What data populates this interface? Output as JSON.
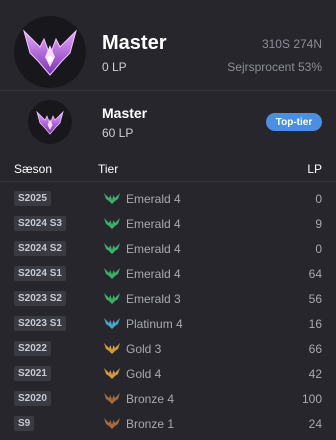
{
  "current": {
    "tier": "Master",
    "lp": "0 LP",
    "record": "310S 274N",
    "winrate": "Sejrsprocent 53%",
    "icon": "master-emblem-icon",
    "color": "#b05adf"
  },
  "peak": {
    "tier": "Master",
    "lp": "60 LP",
    "badge": "Top-tier",
    "badge_color": "#4b8fe3",
    "icon": "master-emblem-icon"
  },
  "table": {
    "headers": {
      "season": "Sæson",
      "tier": "Tier",
      "lp": "LP"
    },
    "rows": [
      {
        "season": "S2025",
        "tier": "Emerald 4",
        "lp": "0",
        "color": "#3fae6a"
      },
      {
        "season": "S2024 S3",
        "tier": "Emerald 4",
        "lp": "9",
        "color": "#3fae6a"
      },
      {
        "season": "S2024 S2",
        "tier": "Emerald 4",
        "lp": "0",
        "color": "#3fae6a"
      },
      {
        "season": "S2024 S1",
        "tier": "Emerald 4",
        "lp": "64",
        "color": "#3fae6a"
      },
      {
        "season": "S2023 S2",
        "tier": "Emerald 3",
        "lp": "56",
        "color": "#3fae6a"
      },
      {
        "season": "S2023 S1",
        "tier": "Platinum 4",
        "lp": "16",
        "color": "#4aa6c8"
      },
      {
        "season": "S2022",
        "tier": "Gold 3",
        "lp": "66",
        "color": "#d49a3a"
      },
      {
        "season": "S2021",
        "tier": "Gold 4",
        "lp": "42",
        "color": "#d49a3a"
      },
      {
        "season": "S2020",
        "tier": "Bronze 4",
        "lp": "100",
        "color": "#a86a3e"
      },
      {
        "season": "S9",
        "tier": "Bronze 1",
        "lp": "24",
        "color": "#a86a3e"
      }
    ]
  }
}
